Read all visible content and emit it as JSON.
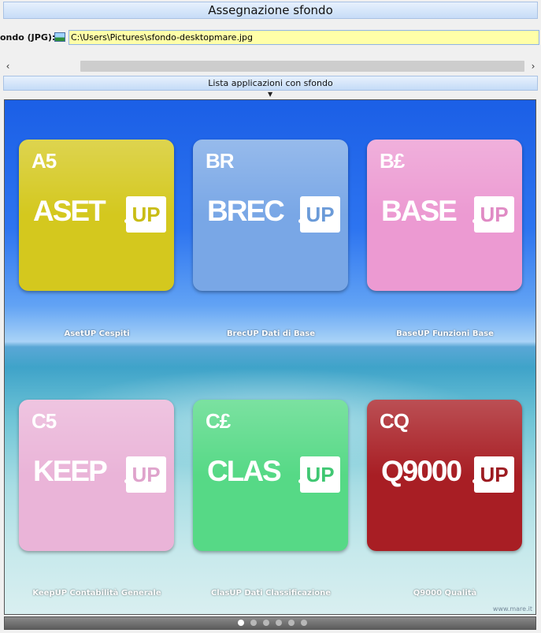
{
  "window": {
    "title": "Assegnazione sfondo"
  },
  "path_field": {
    "label": "ondo (JPG):",
    "icon": "image-file-icon",
    "value": "C:\\Users\\Pictures\\sfondo-desktopmare.jpg"
  },
  "scrollbar": {
    "left_arrow": "‹",
    "right_arrow": "›"
  },
  "section": {
    "title": "Lista applicazioni con sfondo",
    "toggle": "▼"
  },
  "apps": [
    {
      "code": "A5",
      "name": "ASET",
      "badge": "UP",
      "caption": "AsetUP Cespiti",
      "color": "#d4c81e",
      "badge_color": "#c9bd15"
    },
    {
      "code": "BR",
      "name": "BREC",
      "badge": "UP",
      "caption": "BrecUP Dati di Base",
      "color": "#79a7e6",
      "badge_color": "#6a9ad8"
    },
    {
      "code": "B£",
      "name": "BASE",
      "badge": "UP",
      "caption": "BaseUP Funzioni Base",
      "color": "#ec9ad2",
      "badge_color": "#e08ac4"
    },
    {
      "code": "C5",
      "name": "KEEP",
      "badge": "UP",
      "caption": "KeepUP Contabilità Generale",
      "color": "#eab4d8",
      "badge_color": "#dfa3cc"
    },
    {
      "code": "C£",
      "name": "CLAS",
      "badge": "UP",
      "caption": "ClasUP Dati Classificazione",
      "color": "#56d986",
      "badge_color": "#3fc772"
    },
    {
      "code": "CQ",
      "name": "Q9000",
      "badge": "UP",
      "caption": "Q9000 Qualità",
      "color": "#a81e24",
      "badge_color": "#9c1a20"
    }
  ],
  "watermark": "www.mare.it",
  "pager": {
    "pages": 6,
    "current": 0
  }
}
